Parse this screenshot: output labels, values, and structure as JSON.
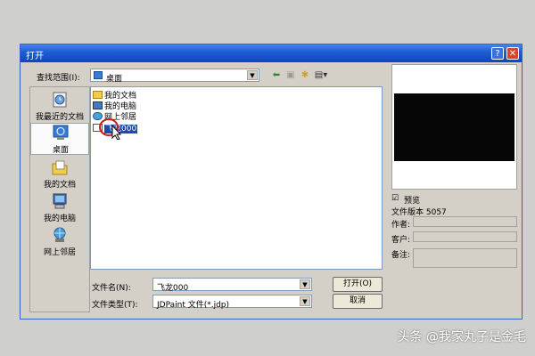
{
  "dialog": {
    "title": "打开",
    "help_label": "?",
    "close_label": "✕"
  },
  "lookin": {
    "label": "查找范围(I):",
    "value": "桌面"
  },
  "places": [
    {
      "label": "我最近的文档",
      "icon": "recent-documents-icon"
    },
    {
      "label": "桌面",
      "icon": "desktop-icon"
    },
    {
      "label": "我的文档",
      "icon": "my-documents-icon"
    },
    {
      "label": "我的电脑",
      "icon": "my-computer-icon"
    },
    {
      "label": "网上邻居",
      "icon": "network-places-icon"
    }
  ],
  "files": [
    {
      "name": "我的文档",
      "icon": "folder-icon"
    },
    {
      "name": "我的电脑",
      "icon": "computer-icon"
    },
    {
      "name": "网上邻居",
      "icon": "network-icon"
    },
    {
      "name": "飞龙000",
      "icon": "jdp-file-icon"
    }
  ],
  "filename": {
    "label": "文件名(N):",
    "value": "飞龙000"
  },
  "filetype": {
    "label": "文件类型(T):",
    "value": "JDPaint 文件(*.jdp)"
  },
  "buttons": {
    "open": "打开(O)",
    "cancel": "取消"
  },
  "preview": {
    "checkbox_mark": "☑",
    "checkbox_label": "预览",
    "version": "文件版本 5057",
    "author_label": "作者:",
    "client_label": "客户:",
    "note_label": "备注:"
  },
  "watermark": "头条 @我家丸子是金毛",
  "colors": {
    "titlebar": "#0a46c4",
    "selection": "#1f4aa8",
    "dialog_face": "#d4d0c8"
  }
}
